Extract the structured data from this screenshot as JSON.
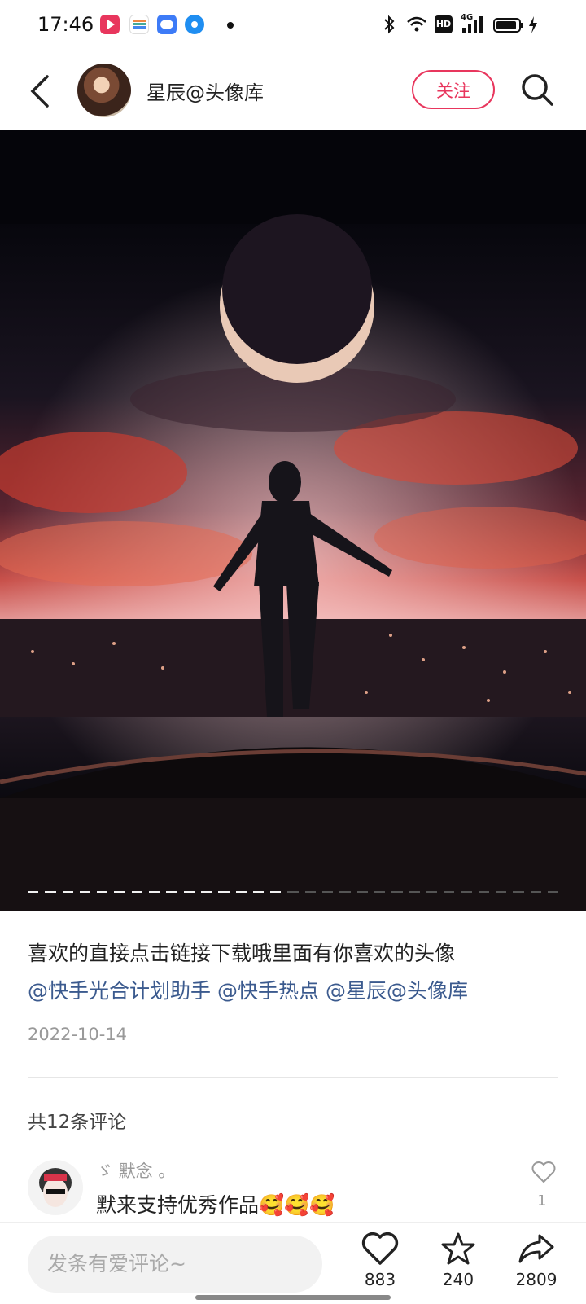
{
  "status_bar": {
    "time": "17:46",
    "notification_icons": [
      "video-app-icon",
      "wallet-app-icon",
      "chat-app-icon",
      "browser-app-icon",
      "more-dot-icon"
    ],
    "right_icons": [
      "bluetooth-icon",
      "wifi-icon",
      "hd-icon",
      "signal-4g-icon",
      "battery-icon",
      "charging-icon"
    ],
    "network_label": "4G",
    "hd_label": "HD"
  },
  "header": {
    "author_name": "星辰@头像库",
    "follow_label": "关注"
  },
  "media": {
    "total_pages": 31,
    "active_pages": 15,
    "colors": {
      "sky": "#0a0a14",
      "cloud": "#e0533d",
      "moon": "#e9c9b6"
    }
  },
  "post": {
    "caption_text": "喜欢的直接点击链接下载哦里面有你喜欢的头像",
    "mentions": [
      "@快手光合计划助手",
      "@快手热点",
      "@星辰@头像库"
    ],
    "date": "2022-10-14"
  },
  "comments": {
    "count_label": "共12条评论",
    "items": [
      {
        "author": "ゞ 默念 。",
        "text": "默来支持优秀作品🥰🥰🥰",
        "likes": "1"
      }
    ]
  },
  "bottom_bar": {
    "input_placeholder": "发条有爱评论~",
    "like_count": "883",
    "favorite_count": "240",
    "share_count": "2809"
  },
  "colors": {
    "accent": "#e8365d",
    "mention": "#3b5a8e"
  }
}
